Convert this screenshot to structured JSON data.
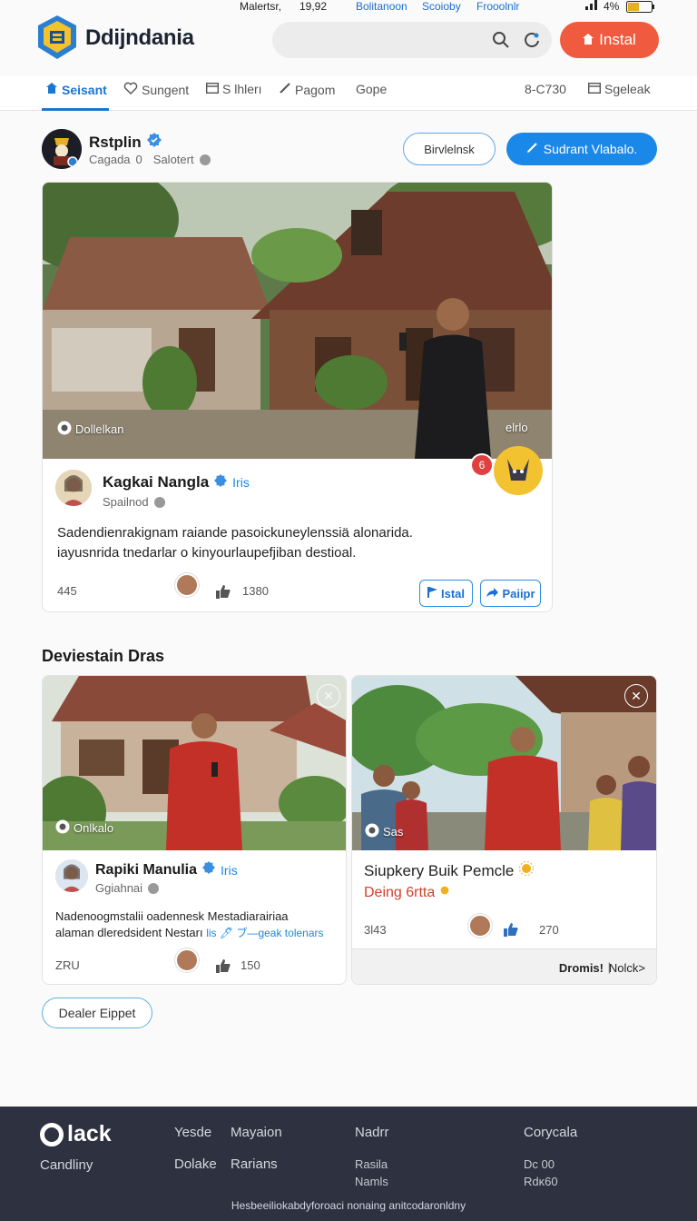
{
  "status_bar": {
    "carrier": "Malertsr,",
    "time": "19,92",
    "link1": "Bolitanoon",
    "link2": "Scoioby",
    "link3": "Frooolnlr",
    "battery": "4%"
  },
  "header": {
    "brand": "Ddijndania",
    "install_label": "Instal"
  },
  "nav": {
    "items": [
      {
        "label": "Seisant"
      },
      {
        "label": "Sungent"
      },
      {
        "label": "S lhlerı"
      },
      {
        "label": "Pagom"
      },
      {
        "label": "Gope"
      },
      {
        "label": "8-C730"
      },
      {
        "label": "Sgeleak"
      }
    ]
  },
  "profile": {
    "name": "Rstplin",
    "stat1": "Cagada",
    "stat1_value": "0",
    "stat2": "Salotert",
    "btn_secondary": "Birvlelnsk",
    "btn_primary": "Sudrant Vlabalo."
  },
  "feature": {
    "photo_tag": "Dollelkan",
    "photo_tag_right": "elrlo",
    "badge_count": "6",
    "author": "Kagkai Nangla",
    "author_tag": "Iris",
    "author_sub": "Spailnod",
    "text_line1": "Sadendienrakignam raiande pasoickuneylenssiä alonarida.",
    "text_line2": "iayusnrida tnedarlar o kinyourlaupefjiban destioal.",
    "count_left": "445",
    "likes": "1380",
    "btn1": "Istal",
    "btn2": "Paiipr"
  },
  "section": {
    "title": "Deviestain Dras"
  },
  "card_left": {
    "photo_tag": "Onlkalo",
    "author": "Rapiki Manulia",
    "author_tag": "Iris",
    "author_sub": "Ggiahnai",
    "text_line1": "Nadenoogmstalii oadennesk Mestadiarairiaa",
    "text_line2": "alaman dleredsident Nestarı",
    "text_link": "lis 🖊 ブ—geak tolenars",
    "count_left": "ZRU",
    "likes": "150"
  },
  "card_right": {
    "photo_tag": "Sas",
    "title": "Siupkery Buik Pemcle",
    "subtitle": "Deing 6rtta",
    "count_left": "3l43",
    "likes": "270",
    "footer_left": "Dromis!",
    "footer_sep": "|",
    "footer_right": "Nolck>"
  },
  "dealer_button": "Dealer Eippet",
  "footer": {
    "brand": "lack",
    "tagline": "Candliny",
    "col1": [
      "Yesde",
      "Dolake"
    ],
    "col2": [
      "Mayaion",
      "Rarians"
    ],
    "col3": [
      "Nadrr",
      "Rasila",
      "Namls"
    ],
    "col4": [
      "Corycala",
      "Dc 00",
      "Rdκ60"
    ],
    "bottom": "Hesbeeiliokabdyforoaci nonaing anitcodaronldny"
  },
  "colors": {
    "accent_blue": "#1a88e8",
    "install_orange": "#f05a3e",
    "footer_bg": "#2d3140"
  }
}
